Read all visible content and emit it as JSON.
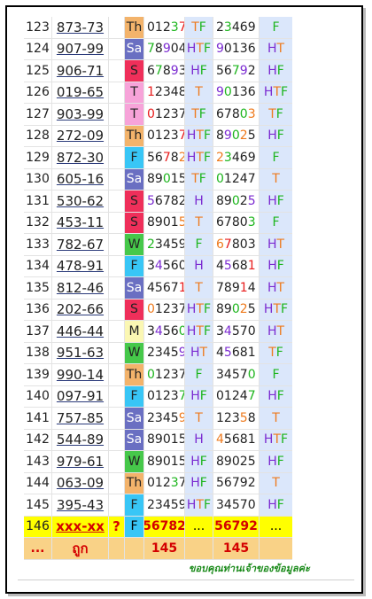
{
  "rows": [
    {
      "num": "123",
      "date": "873-73",
      "day": "Th",
      "d1": [
        [
          "0",
          "n"
        ],
        [
          "1",
          "n"
        ],
        [
          "2",
          "n"
        ],
        [
          "3",
          "g"
        ],
        [
          "7",
          "r"
        ]
      ],
      "t1": [
        [
          "T",
          "o"
        ],
        [
          "F",
          "g"
        ]
      ],
      "d2": [
        [
          "2",
          "n"
        ],
        [
          "3",
          "g"
        ],
        [
          "4",
          "n"
        ],
        [
          "6",
          "n"
        ],
        [
          "9",
          "n"
        ]
      ],
      "t2": [
        [
          "F",
          "g"
        ]
      ]
    },
    {
      "num": "124",
      "date": "907-99",
      "day": "Sa",
      "d1": [
        [
          "7",
          "g"
        ],
        [
          "8",
          "n"
        ],
        [
          "9",
          "p"
        ],
        [
          "0",
          "n"
        ],
        [
          "4",
          "n"
        ]
      ],
      "t1": [
        [
          "H",
          "p"
        ],
        [
          "T",
          "o"
        ],
        [
          "F",
          "g"
        ]
      ],
      "d2": [
        [
          "9",
          "p"
        ],
        [
          "0",
          "n"
        ],
        [
          "1",
          "n"
        ],
        [
          "3",
          "n"
        ],
        [
          "6",
          "n"
        ]
      ],
      "t2": [
        [
          "H",
          "p"
        ],
        [
          "T",
          "o"
        ]
      ]
    },
    {
      "num": "125",
      "date": "906-71",
      "day": "S",
      "d1": [
        [
          "6",
          "n"
        ],
        [
          "7",
          "g"
        ],
        [
          "8",
          "n"
        ],
        [
          "9",
          "p"
        ],
        [
          "3",
          "n"
        ]
      ],
      "t1": [
        [
          "H",
          "p"
        ],
        [
          "F",
          "g"
        ]
      ],
      "d2": [
        [
          "5",
          "n"
        ],
        [
          "6",
          "n"
        ],
        [
          "7",
          "g"
        ],
        [
          "9",
          "p"
        ],
        [
          "2",
          "n"
        ]
      ],
      "t2": [
        [
          "H",
          "p"
        ],
        [
          "F",
          "g"
        ]
      ]
    },
    {
      "num": "126",
      "date": "019-65",
      "day": "T",
      "d1": [
        [
          "1",
          "r"
        ],
        [
          "2",
          "n"
        ],
        [
          "3",
          "n"
        ],
        [
          "4",
          "n"
        ],
        [
          "8",
          "n"
        ]
      ],
      "t1": [
        [
          "T",
          "o"
        ]
      ],
      "d2": [
        [
          "9",
          "p"
        ],
        [
          "0",
          "g"
        ],
        [
          "1",
          "n"
        ],
        [
          "3",
          "n"
        ],
        [
          "6",
          "n"
        ]
      ],
      "t2": [
        [
          "H",
          "p"
        ],
        [
          "T",
          "o"
        ],
        [
          "F",
          "g"
        ]
      ]
    },
    {
      "num": "127",
      "date": "903-99",
      "day": "T",
      "d1": [
        [
          "0",
          "r"
        ],
        [
          "1",
          "n"
        ],
        [
          "2",
          "n"
        ],
        [
          "3",
          "n"
        ],
        [
          "7",
          "n"
        ]
      ],
      "t1": [
        [
          "T",
          "o"
        ],
        [
          "F",
          "g"
        ]
      ],
      "d2": [
        [
          "6",
          "n"
        ],
        [
          "7",
          "n"
        ],
        [
          "8",
          "n"
        ],
        [
          "0",
          "g"
        ],
        [
          "3",
          "o"
        ]
      ],
      "t2": [
        [
          "T",
          "o"
        ],
        [
          "F",
          "g"
        ]
      ]
    },
    {
      "num": "128",
      "date": "272-09",
      "day": "Th",
      "d1": [
        [
          "0",
          "n"
        ],
        [
          "1",
          "n"
        ],
        [
          "2",
          "n"
        ],
        [
          "3",
          "n"
        ],
        [
          "7",
          "r"
        ]
      ],
      "t1": [
        [
          "H",
          "p"
        ],
        [
          "T",
          "o"
        ],
        [
          "F",
          "g"
        ]
      ],
      "d2": [
        [
          "8",
          "n"
        ],
        [
          "9",
          "p"
        ],
        [
          "0",
          "g"
        ],
        [
          "2",
          "o"
        ],
        [
          "5",
          "n"
        ]
      ],
      "t2": [
        [
          "H",
          "p"
        ],
        [
          "F",
          "g"
        ]
      ]
    },
    {
      "num": "129",
      "date": "872-30",
      "day": "F",
      "d1": [
        [
          "5",
          "n"
        ],
        [
          "6",
          "n"
        ],
        [
          "7",
          "r"
        ],
        [
          "8",
          "n"
        ],
        [
          "2",
          "o"
        ]
      ],
      "t1": [
        [
          "H",
          "p"
        ],
        [
          "T",
          "o"
        ],
        [
          "F",
          "g"
        ]
      ],
      "d2": [
        [
          "2",
          "o"
        ],
        [
          "3",
          "g"
        ],
        [
          "4",
          "n"
        ],
        [
          "6",
          "n"
        ],
        [
          "9",
          "n"
        ]
      ],
      "t2": [
        [
          "F",
          "g"
        ]
      ]
    },
    {
      "num": "130",
      "date": "605-16",
      "day": "Sa",
      "d1": [
        [
          "8",
          "n"
        ],
        [
          "9",
          "n"
        ],
        [
          "0",
          "g"
        ],
        [
          "1",
          "n"
        ],
        [
          "5",
          "n"
        ]
      ],
      "t1": [
        [
          "T",
          "o"
        ],
        [
          "F",
          "g"
        ]
      ],
      "d2": [
        [
          "0",
          "g"
        ],
        [
          "1",
          "n"
        ],
        [
          "2",
          "n"
        ],
        [
          "4",
          "n"
        ],
        [
          "7",
          "n"
        ]
      ],
      "t2": [
        [
          "T",
          "o"
        ]
      ]
    },
    {
      "num": "131",
      "date": "530-62",
      "day": "S",
      "d1": [
        [
          "5",
          "p"
        ],
        [
          "6",
          "n"
        ],
        [
          "7",
          "n"
        ],
        [
          "8",
          "n"
        ],
        [
          "2",
          "n"
        ]
      ],
      "t1": [
        [
          "H",
          "p"
        ]
      ],
      "d2": [
        [
          "8",
          "n"
        ],
        [
          "9",
          "n"
        ],
        [
          "0",
          "g"
        ],
        [
          "2",
          "n"
        ],
        [
          "5",
          "p"
        ]
      ],
      "t2": [
        [
          "H",
          "p"
        ],
        [
          "F",
          "g"
        ]
      ]
    },
    {
      "num": "132",
      "date": "453-11",
      "day": "S",
      "d1": [
        [
          "8",
          "n"
        ],
        [
          "9",
          "n"
        ],
        [
          "0",
          "n"
        ],
        [
          "1",
          "n"
        ],
        [
          "5",
          "o"
        ]
      ],
      "t1": [
        [
          "T",
          "o"
        ]
      ],
      "d2": [
        [
          "6",
          "n"
        ],
        [
          "7",
          "n"
        ],
        [
          "8",
          "n"
        ],
        [
          "0",
          "n"
        ],
        [
          "3",
          "g"
        ]
      ],
      "t2": [
        [
          "F",
          "g"
        ]
      ]
    },
    {
      "num": "133",
      "date": "782-67",
      "day": "W",
      "d1": [
        [
          "2",
          "g"
        ],
        [
          "3",
          "n"
        ],
        [
          "4",
          "n"
        ],
        [
          "5",
          "n"
        ],
        [
          "9",
          "n"
        ]
      ],
      "t1": [
        [
          "F",
          "g"
        ]
      ],
      "d2": [
        [
          "6",
          "o"
        ],
        [
          "7",
          "r"
        ],
        [
          "8",
          "n"
        ],
        [
          "0",
          "n"
        ],
        [
          "3",
          "n"
        ]
      ],
      "t2": [
        [
          "H",
          "p"
        ],
        [
          "T",
          "o"
        ]
      ]
    },
    {
      "num": "134",
      "date": "478-91",
      "day": "F",
      "d1": [
        [
          "3",
          "n"
        ],
        [
          "4",
          "p"
        ],
        [
          "5",
          "n"
        ],
        [
          "6",
          "n"
        ],
        [
          "0",
          "n"
        ]
      ],
      "t1": [
        [
          "H",
          "p"
        ]
      ],
      "d2": [
        [
          "4",
          "n"
        ],
        [
          "5",
          "p"
        ],
        [
          "6",
          "n"
        ],
        [
          "8",
          "n"
        ],
        [
          "1",
          "r"
        ]
      ],
      "t2": [
        [
          "H",
          "p"
        ],
        [
          "F",
          "g"
        ]
      ]
    },
    {
      "num": "135",
      "date": "812-46",
      "day": "Sa",
      "d1": [
        [
          "4",
          "n"
        ],
        [
          "5",
          "n"
        ],
        [
          "6",
          "n"
        ],
        [
          "7",
          "n"
        ],
        [
          "1",
          "r"
        ]
      ],
      "t1": [
        [
          "T",
          "o"
        ]
      ],
      "d2": [
        [
          "7",
          "n"
        ],
        [
          "8",
          "n"
        ],
        [
          "9",
          "n"
        ],
        [
          "1",
          "r"
        ],
        [
          "4",
          "n"
        ]
      ],
      "t2": [
        [
          "H",
          "p"
        ],
        [
          "T",
          "o"
        ]
      ]
    },
    {
      "num": "136",
      "date": "202-66",
      "day": "S",
      "d1": [
        [
          "0",
          "o"
        ],
        [
          "1",
          "n"
        ],
        [
          "2",
          "n"
        ],
        [
          "3",
          "n"
        ],
        [
          "7",
          "n"
        ]
      ],
      "t1": [
        [
          "H",
          "p"
        ],
        [
          "T",
          "o"
        ],
        [
          "F",
          "g"
        ]
      ],
      "d2": [
        [
          "8",
          "n"
        ],
        [
          "9",
          "n"
        ],
        [
          "0",
          "g"
        ],
        [
          "2",
          "o"
        ],
        [
          "5",
          "n"
        ]
      ],
      "t2": [
        [
          "H",
          "p"
        ],
        [
          "T",
          "o"
        ],
        [
          "F",
          "g"
        ]
      ]
    },
    {
      "num": "137",
      "date": "446-44",
      "day": "M",
      "d1": [
        [
          "3",
          "n"
        ],
        [
          "4",
          "p"
        ],
        [
          "5",
          "n"
        ],
        [
          "6",
          "n"
        ],
        [
          "0",
          "g"
        ]
      ],
      "t1": [
        [
          "H",
          "p"
        ],
        [
          "T",
          "o"
        ],
        [
          "F",
          "g"
        ]
      ],
      "d2": [
        [
          "3",
          "n"
        ],
        [
          "4",
          "p"
        ],
        [
          "5",
          "n"
        ],
        [
          "7",
          "n"
        ],
        [
          "0",
          "n"
        ]
      ],
      "t2": [
        [
          "H",
          "p"
        ],
        [
          "T",
          "o"
        ]
      ]
    },
    {
      "num": "138",
      "date": "951-63",
      "day": "W",
      "d1": [
        [
          "2",
          "n"
        ],
        [
          "3",
          "n"
        ],
        [
          "4",
          "n"
        ],
        [
          "5",
          "n"
        ],
        [
          "9",
          "p"
        ]
      ],
      "t1": [
        [
          "H",
          "p"
        ],
        [
          "T",
          "o"
        ]
      ],
      "d2": [
        [
          "4",
          "n"
        ],
        [
          "5",
          "p"
        ],
        [
          "6",
          "n"
        ],
        [
          "8",
          "n"
        ],
        [
          "1",
          "n"
        ]
      ],
      "t2": [
        [
          "T",
          "o"
        ],
        [
          "F",
          "g"
        ]
      ]
    },
    {
      "num": "139",
      "date": "990-14",
      "day": "Th",
      "d1": [
        [
          "0",
          "g"
        ],
        [
          "1",
          "n"
        ],
        [
          "2",
          "n"
        ],
        [
          "3",
          "n"
        ],
        [
          "7",
          "n"
        ]
      ],
      "t1": [
        [
          "F",
          "g"
        ]
      ],
      "d2": [
        [
          "3",
          "n"
        ],
        [
          "4",
          "n"
        ],
        [
          "5",
          "n"
        ],
        [
          "7",
          "n"
        ],
        [
          "0",
          "g"
        ]
      ],
      "t2": [
        [
          "F",
          "g"
        ]
      ]
    },
    {
      "num": "140",
      "date": "097-91",
      "day": "F",
      "d1": [
        [
          "0",
          "n"
        ],
        [
          "1",
          "n"
        ],
        [
          "2",
          "n"
        ],
        [
          "3",
          "n"
        ],
        [
          "7",
          "g"
        ]
      ],
      "t1": [
        [
          "H",
          "p"
        ],
        [
          "F",
          "g"
        ]
      ],
      "d2": [
        [
          "0",
          "n"
        ],
        [
          "1",
          "n"
        ],
        [
          "2",
          "n"
        ],
        [
          "4",
          "n"
        ],
        [
          "7",
          "g"
        ]
      ],
      "t2": [
        [
          "H",
          "p"
        ],
        [
          "F",
          "g"
        ]
      ]
    },
    {
      "num": "141",
      "date": "757-85",
      "day": "Sa",
      "d1": [
        [
          "2",
          "n"
        ],
        [
          "3",
          "n"
        ],
        [
          "4",
          "n"
        ],
        [
          "5",
          "n"
        ],
        [
          "9",
          "o"
        ]
      ],
      "t1": [
        [
          "T",
          "o"
        ]
      ],
      "d2": [
        [
          "1",
          "n"
        ],
        [
          "2",
          "n"
        ],
        [
          "3",
          "n"
        ],
        [
          "5",
          "o"
        ],
        [
          "8",
          "n"
        ]
      ],
      "t2": [
        [
          "T",
          "o"
        ]
      ]
    },
    {
      "num": "142",
      "date": "544-89",
      "day": "Sa",
      "d1": [
        [
          "8",
          "n"
        ],
        [
          "9",
          "n"
        ],
        [
          "0",
          "n"
        ],
        [
          "1",
          "n"
        ],
        [
          "5",
          "n"
        ]
      ],
      "t1": [
        [
          "H",
          "p"
        ]
      ],
      "d2": [
        [
          "4",
          "o"
        ],
        [
          "5",
          "n"
        ],
        [
          "6",
          "n"
        ],
        [
          "8",
          "n"
        ],
        [
          "1",
          "n"
        ]
      ],
      "t2": [
        [
          "H",
          "p"
        ],
        [
          "T",
          "o"
        ],
        [
          "F",
          "g"
        ]
      ]
    },
    {
      "num": "143",
      "date": "979-61",
      "day": "W",
      "d1": [
        [
          "8",
          "n"
        ],
        [
          "9",
          "n"
        ],
        [
          "0",
          "n"
        ],
        [
          "1",
          "n"
        ],
        [
          "5",
          "n"
        ]
      ],
      "t1": [
        [
          "H",
          "p"
        ],
        [
          "F",
          "g"
        ]
      ],
      "d2": [
        [
          "8",
          "n"
        ],
        [
          "9",
          "n"
        ],
        [
          "0",
          "n"
        ],
        [
          "2",
          "n"
        ],
        [
          "5",
          "n"
        ]
      ],
      "t2": [
        [
          "H",
          "p"
        ],
        [
          "F",
          "g"
        ]
      ]
    },
    {
      "num": "144",
      "date": "063-09",
      "day": "Th",
      "d1": [
        [
          "0",
          "n"
        ],
        [
          "1",
          "n"
        ],
        [
          "2",
          "n"
        ],
        [
          "3",
          "g"
        ],
        [
          "7",
          "n"
        ]
      ],
      "t1": [
        [
          "H",
          "p"
        ],
        [
          "F",
          "g"
        ]
      ],
      "d2": [
        [
          "5",
          "n"
        ],
        [
          "6",
          "n"
        ],
        [
          "7",
          "n"
        ],
        [
          "9",
          "n"
        ],
        [
          "2",
          "n"
        ]
      ],
      "t2": [
        [
          "T",
          "o"
        ]
      ]
    },
    {
      "num": "145",
      "date": "395-43",
      "day": "F",
      "d1": [
        [
          "2",
          "n"
        ],
        [
          "3",
          "n"
        ],
        [
          "4",
          "n"
        ],
        [
          "5",
          "n"
        ],
        [
          "9",
          "n"
        ]
      ],
      "t1": [
        [
          "H",
          "p"
        ],
        [
          "T",
          "o"
        ],
        [
          "F",
          "g"
        ]
      ],
      "d2": [
        [
          "3",
          "n"
        ],
        [
          "4",
          "n"
        ],
        [
          "5",
          "n"
        ],
        [
          "7",
          "n"
        ],
        [
          "0",
          "n"
        ]
      ],
      "t2": [
        [
          "H",
          "p"
        ],
        [
          "F",
          "g"
        ]
      ]
    }
  ],
  "highlight": {
    "num": "146",
    "date": "xxx-xx",
    "q": "?",
    "day": "F",
    "d1": "56782",
    "t1": "...",
    "d2": "56792",
    "t2": "..."
  },
  "footer": {
    "left": "...",
    "label": "ถูก",
    "n1": "145",
    "n2": "145"
  },
  "thanks": "ขอบคุณท่านเจ้าของข้อมูลค่ะ",
  "colors": {
    "green": "#1db51d",
    "orange": "#ee7a1d",
    "red": "#e81c1c",
    "purple": "#7b2bd1",
    "highlight": "#ffff00",
    "footer": "#f9d287"
  }
}
